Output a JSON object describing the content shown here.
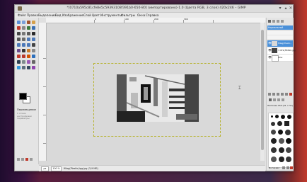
{
  "window": {
    "title": "*[0710a595c81cfe8e5c59393108f391b0-650-80] (импортировано)-1.0 (Цвета RGB, 3 слоя) 420x246 – GIMP"
  },
  "menu": [
    "Файл",
    "Правка",
    "Выделение",
    "Вид",
    "Изображение",
    "Слой",
    "Цвет",
    "Инструменты",
    "Фильтры",
    "Окна",
    "Справка"
  ],
  "ruler_labels": [
    "0",
    "100",
    "200",
    "300"
  ],
  "tool_options": {
    "title": "Перемещение",
    "subtitle": "С этими настройками параметры"
  },
  "status": {
    "unit": "px",
    "zoom": "100 %",
    "text": "fillag(Plastic)ipg.jpg (3,9 МБ)"
  },
  "layers": {
    "mode": "Нормальный",
    "items": [
      {
        "name": "fillag(Plasti...",
        "selected": true
      },
      {
        "name": "7-9F2(F8890.jpg",
        "selected": false
      },
      {
        "name": "Фон",
        "selected": false
      }
    ]
  },
  "brushes": {
    "header": "Hardness 050 (51 × 51)",
    "spacing_label": "Интервал"
  },
  "colors": {
    "accent": "#4a90d9",
    "selection_border": "#b7b330",
    "foreground": "#000000",
    "background": "#ffffff"
  }
}
